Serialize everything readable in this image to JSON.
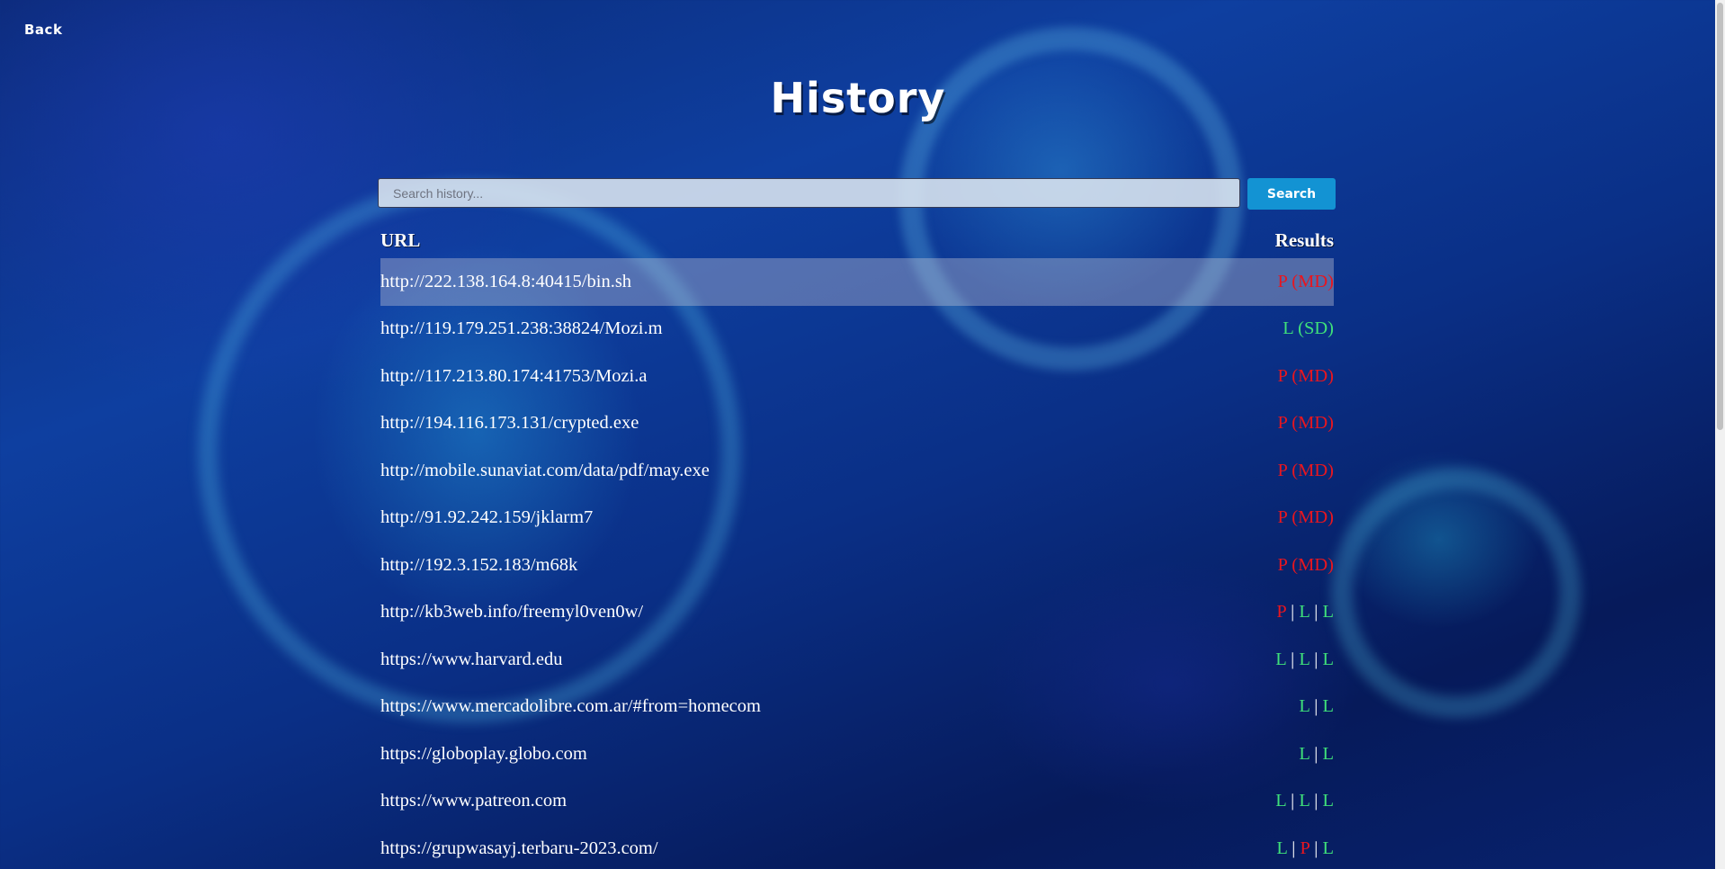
{
  "nav": {
    "back_label": "Back"
  },
  "page": {
    "title": "History"
  },
  "search": {
    "placeholder": "Search history...",
    "button_label": "Search"
  },
  "table": {
    "headers": {
      "url": "URL",
      "results": "Results"
    },
    "rows": [
      {
        "url": "http://222.138.164.8:40415/bin.sh",
        "results": [
          {
            "t": "P (MD)",
            "c": "P"
          }
        ]
      },
      {
        "url": "http://119.179.251.238:38824/Mozi.m",
        "results": [
          {
            "t": "L (SD)",
            "c": "L"
          }
        ]
      },
      {
        "url": "http://117.213.80.174:41753/Mozi.a",
        "results": [
          {
            "t": "P (MD)",
            "c": "P"
          }
        ]
      },
      {
        "url": "http://194.116.173.131/crypted.exe",
        "results": [
          {
            "t": "P (MD)",
            "c": "P"
          }
        ]
      },
      {
        "url": "http://mobile.sunaviat.com/data/pdf/may.exe",
        "results": [
          {
            "t": "P (MD)",
            "c": "P"
          }
        ]
      },
      {
        "url": "http://91.92.242.159/jklarm7",
        "results": [
          {
            "t": "P (MD)",
            "c": "P"
          }
        ]
      },
      {
        "url": "http://192.3.152.183/m68k",
        "results": [
          {
            "t": "P (MD)",
            "c": "P"
          }
        ]
      },
      {
        "url": "http://kb3web.info/freemyl0ven0w/",
        "results": [
          {
            "t": "P",
            "c": "P"
          },
          {
            "t": "L",
            "c": "L"
          },
          {
            "t": "L",
            "c": "L"
          }
        ]
      },
      {
        "url": "https://www.harvard.edu",
        "results": [
          {
            "t": "L",
            "c": "L"
          },
          {
            "t": "L",
            "c": "L"
          },
          {
            "t": "L",
            "c": "L"
          }
        ]
      },
      {
        "url": "https://www.mercadolibre.com.ar/#from=homecom",
        "results": [
          {
            "t": "L",
            "c": "L"
          },
          {
            "t": "L",
            "c": "L"
          }
        ]
      },
      {
        "url": "https://globoplay.globo.com",
        "results": [
          {
            "t": "L",
            "c": "L"
          },
          {
            "t": "L",
            "c": "L"
          }
        ]
      },
      {
        "url": "https://www.patreon.com",
        "results": [
          {
            "t": "L",
            "c": "L"
          },
          {
            "t": "L",
            "c": "L"
          },
          {
            "t": "L",
            "c": "L"
          }
        ]
      },
      {
        "url": "https://grupwasayj.terbaru-2023.com/",
        "results": [
          {
            "t": "L",
            "c": "L"
          },
          {
            "t": "P",
            "c": "P"
          },
          {
            "t": "L",
            "c": "L"
          }
        ]
      }
    ],
    "result_separator": "|"
  },
  "colors": {
    "phishing_red": "#e8161f",
    "legit_green": "#3fe07a",
    "search_button": "#1393d3",
    "highlight_row": "rgba(200,200,215,0.38)"
  }
}
